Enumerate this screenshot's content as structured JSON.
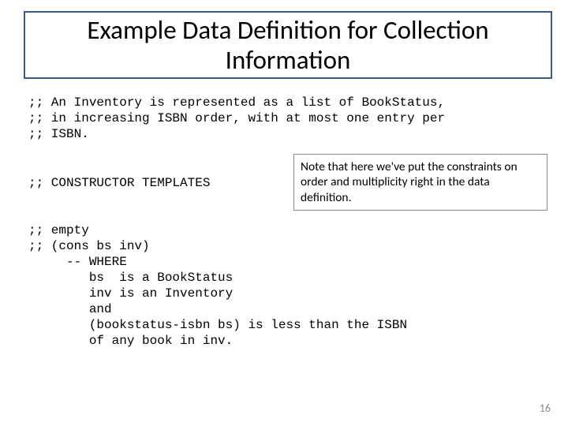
{
  "title": "Example Data Definition for Collection Information",
  "code": {
    "intro": ";; An Inventory is represented as a list of BookStatus,\n;; in increasing ISBN order, with at most one entry per\n;; ISBN.",
    "ctor_header": ";; CONSTRUCTOR TEMPLATES",
    "ctor_body": ";; empty\n;; (cons bs inv)\n     -- WHERE\n        bs  is a BookStatus\n        inv is an Inventory\n        and\n        (bookstatus-isbn bs) is less than the ISBN\n        of any book in inv."
  },
  "note": "Note that here we've put the constraints on order and multiplicity right in the data definition.",
  "page_number": "16"
}
